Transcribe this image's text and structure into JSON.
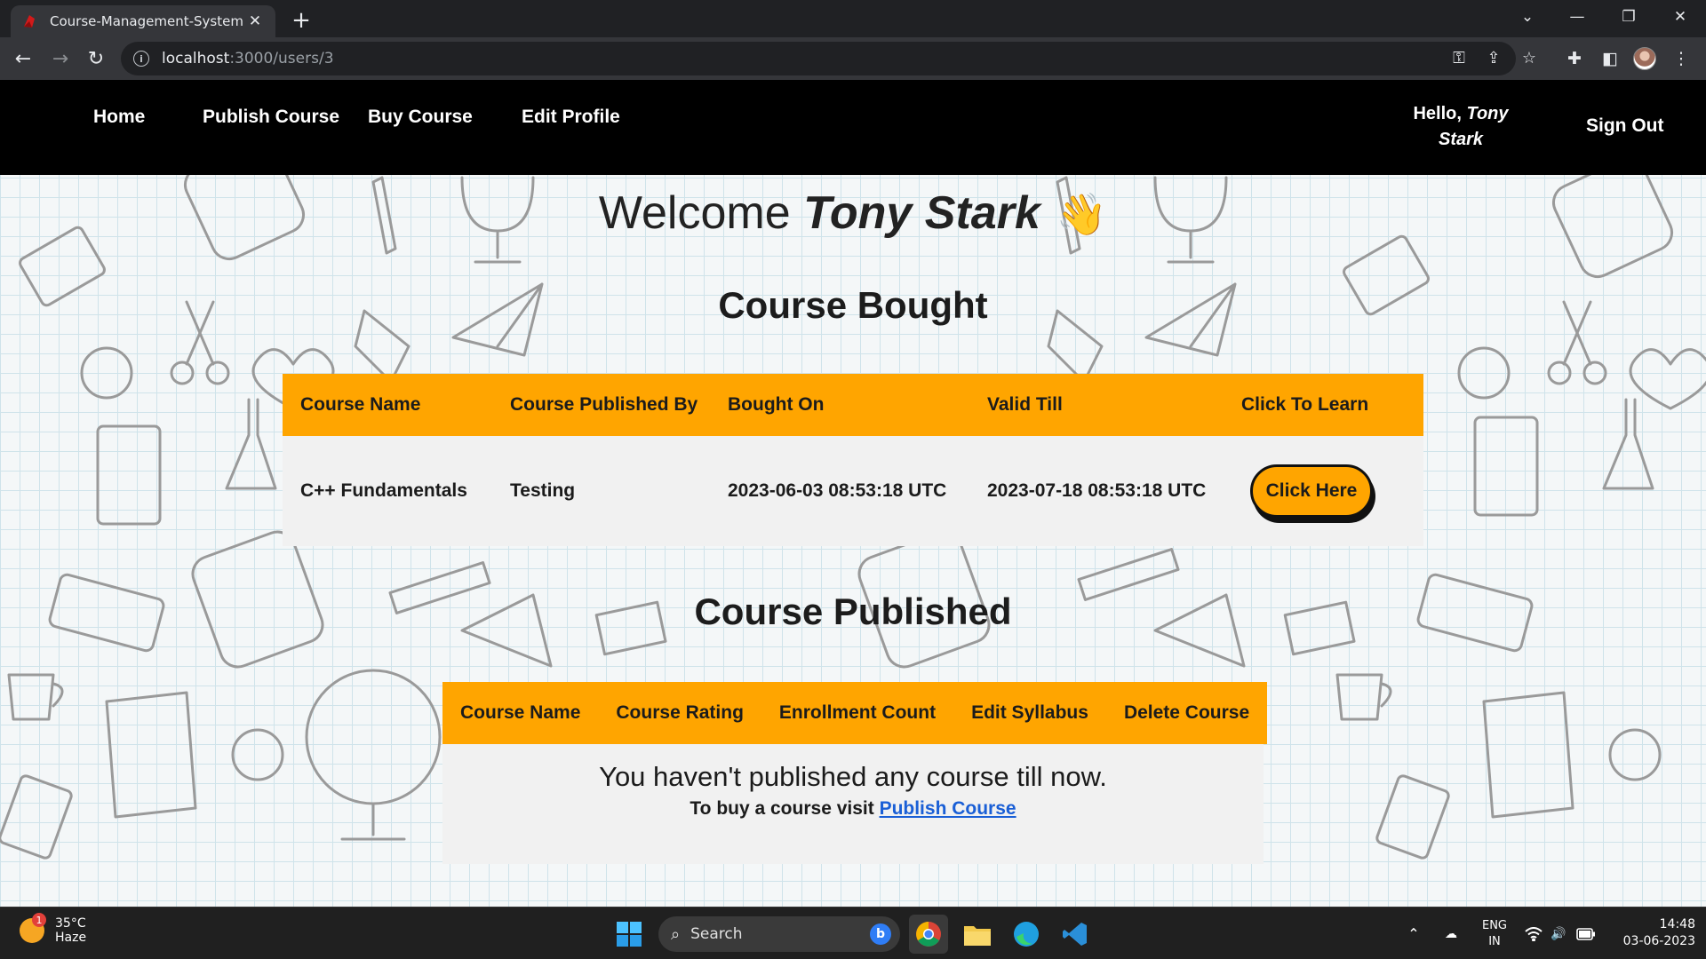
{
  "browser": {
    "tab_title": "Course-Management-System",
    "tab_close": "✕",
    "new_tab": "+",
    "url_host": "localhost",
    "url_path": ":3000/users/3",
    "window_controls": {
      "dropdown": "⌄",
      "minimize": "—",
      "restore": "❐",
      "close": "✕"
    }
  },
  "navbar": {
    "links": [
      "Home",
      "Publish Course",
      "Buy Course",
      "Edit Profile"
    ],
    "hello_prefix": "Hello, ",
    "user_name": "Tony Stark",
    "sign_out": "Sign Out"
  },
  "welcome": {
    "prefix": "Welcome ",
    "name": "Tony Stark",
    "emoji": "👋"
  },
  "bought": {
    "heading": "Course Bought",
    "columns": [
      "Course Name",
      "Course Published By",
      "Bought On",
      "Valid Till",
      "Click To Learn"
    ],
    "rows": [
      {
        "course_name": "C++ Fundamentals",
        "published_by": "Testing",
        "bought_on": "2023-06-03 08:53:18 UTC",
        "valid_till": "2023-07-18 08:53:18 UTC",
        "button": "Click Here"
      }
    ]
  },
  "published": {
    "heading": "Course Published",
    "columns": [
      "Course Name",
      "Course Rating",
      "Enrollment Count",
      "Edit Syllabus",
      "Delete Course"
    ],
    "empty_message": "You haven't published any course till now.",
    "sub_prefix": "To buy a course visit ",
    "sub_link": "Publish Course"
  },
  "taskbar": {
    "weather_temp": "35°C",
    "weather_desc": "Haze",
    "weather_badge": "1",
    "search_placeholder": "Search",
    "lang_top": "ENG",
    "lang_bottom": "IN",
    "time": "14:48",
    "date": "03-06-2023"
  },
  "colors": {
    "accent": "#ffa500",
    "navbar": "#000000",
    "link": "#1a5fd6"
  }
}
